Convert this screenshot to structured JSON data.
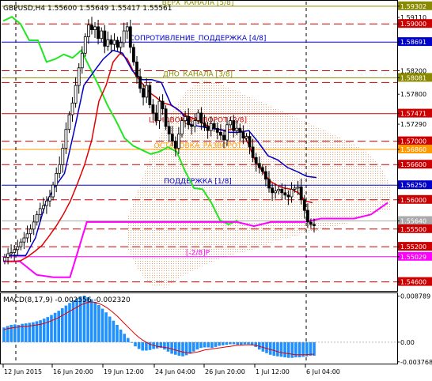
{
  "header": {
    "symbol_line": "GBPUSD,H4  1.55600 1.55649 1.55417 1.55561"
  },
  "colors": {
    "candle": "#000000",
    "red_line": "#e00000",
    "blue_line": "#0000c8",
    "green_line": "#22e622",
    "magenta_line": "#ff00ff",
    "cloud": "#e8a070",
    "macd_hist": "#1e90ff",
    "macd_signal": "#e00000"
  },
  "chart_data": [
    {
      "type": "candlestick",
      "title": "GBPUSD,H4",
      "ohlc_current": {
        "open": 1.556,
        "high": 1.55649,
        "low": 1.55417,
        "close": 1.55561
      },
      "ylim": [
        1.5446,
        1.5938
      ],
      "levels": [
        {
          "label": "ВЕРХ_КАНАЛА [5/8]",
          "price": 1.593,
          "color": "#8a8a00",
          "style": "solid"
        },
        {
          "label": "",
          "price": 1.59,
          "color": "#cc0000",
          "style": "dashed"
        },
        {
          "label": "СОПРОТИВЛЕНИЕ_ПОДДЕРЖКА [4/8]",
          "price": 1.5869,
          "color": "#0000cc",
          "style": "solid"
        },
        {
          "label": "",
          "price": 1.582,
          "color": "#cc0000",
          "style": "dashed"
        },
        {
          "label": "ДНО_КАНАЛА [3/8]",
          "price": 1.5808,
          "color": "#8a8a00",
          "style": "solid"
        },
        {
          "label": "",
          "price": 1.58,
          "color": "#cc0000",
          "style": "dashed"
        },
        {
          "label": "",
          "price": 1.5747,
          "color": "#cc0000",
          "style": "solid"
        },
        {
          "label": "ЦЕНОВОЙ_РАЗВОРОТ [2/8]",
          "price": 1.573,
          "color": "#cc0000",
          "style": "label"
        },
        {
          "label": "",
          "price": 1.57,
          "color": "#cc0000",
          "style": "dashed"
        },
        {
          "label": "ОСТАНОВКА_РАЗВОРОТ",
          "price": 1.5686,
          "color": "#ff9900",
          "style": "solid"
        },
        {
          "label": "",
          "price": 1.566,
          "color": "#cc0000",
          "style": "dashed"
        },
        {
          "label": "ПОДДЕРЖКА [1/8]",
          "price": 1.5625,
          "color": "#0000cc",
          "style": "solid"
        },
        {
          "label": "",
          "price": 1.56,
          "color": "#cc0000",
          "style": "dashed"
        },
        {
          "label": "",
          "price": 1.5564,
          "color": "#aaaaaa",
          "style": "solid"
        },
        {
          "label": "",
          "price": 1.555,
          "color": "#cc0000",
          "style": "dashed"
        },
        {
          "label": "",
          "price": 1.552,
          "color": "#cc0000",
          "style": "dashed"
        },
        {
          "label": "[-2/8]P",
          "price": 1.5503,
          "color": "#ff00ff",
          "style": "solid"
        },
        {
          "label": "",
          "price": 1.546,
          "color": "#cc0000",
          "style": "dashed"
        }
      ],
      "price_axis": [
        {
          "label": "1.59302",
          "price": 1.59302,
          "box": "#8a8a00"
        },
        {
          "label": "1.59110",
          "price": 1.5911,
          "box": ""
        },
        {
          "label": "1.59000",
          "price": 1.59,
          "box": "#cc0000"
        },
        {
          "label": "1.58691",
          "price": 1.58691,
          "box": "#0000cc"
        },
        {
          "label": "1.58200",
          "price": 1.582,
          "box": ""
        },
        {
          "label": "1.58081",
          "price": 1.58081,
          "box": "#8a8a00"
        },
        {
          "label": "1.57800",
          "price": 1.578,
          "box": ""
        },
        {
          "label": "1.57471",
          "price": 1.57471,
          "box": "#cc0000"
        },
        {
          "label": "1.57290",
          "price": 1.5729,
          "box": ""
        },
        {
          "label": "1.57000",
          "price": 1.57,
          "box": "#cc0000"
        },
        {
          "label": "1.56860",
          "price": 1.5686,
          "box": "#ff9900"
        },
        {
          "label": "1.56600",
          "price": 1.566,
          "box": "#cc0000"
        },
        {
          "label": "1.56250",
          "price": 1.5625,
          "box": "#0000cc"
        },
        {
          "label": "1.56000",
          "price": 1.56,
          "box": "#cc0000"
        },
        {
          "label": "1.55640",
          "price": 1.5564,
          "box": "#aaaaaa"
        },
        {
          "label": "1.55500",
          "price": 1.555,
          "box": "#cc0000"
        },
        {
          "label": "1.55200",
          "price": 1.552,
          "box": "#cc0000"
        },
        {
          "label": "1.55029",
          "price": 1.55029,
          "box": "#ff00ff"
        },
        {
          "label": "1.54600",
          "price": 1.546,
          "box": "#cc0000"
        }
      ],
      "time_axis": [
        "12 Jun 2015",
        "16 Jun 20:00",
        "19 Jun 12:00",
        "24 Jun 04:00",
        "26 Jun 20:00",
        "1 Jul 12:00",
        "6 Jul 04:00"
      ],
      "closes": [
        1.5502,
        1.5508,
        1.551,
        1.5515,
        1.552,
        1.5528,
        1.5535,
        1.5542,
        1.555,
        1.5562,
        1.5575,
        1.5585,
        1.559,
        1.5598,
        1.5605,
        1.5625,
        1.5645,
        1.566,
        1.5688,
        1.572,
        1.5745,
        1.5765,
        1.5795,
        1.5825,
        1.585,
        1.5878,
        1.5898,
        1.589,
        1.5895,
        1.5875,
        1.5888,
        1.5862,
        1.5873,
        1.5865,
        1.5872,
        1.586,
        1.5868,
        1.5888,
        1.5895,
        1.586,
        1.5835,
        1.581,
        1.579,
        1.5775,
        1.5795,
        1.5762,
        1.5748,
        1.5735,
        1.5768,
        1.5755,
        1.5725,
        1.5712,
        1.57,
        1.5688,
        1.5712,
        1.5735,
        1.5742,
        1.5728,
        1.5725,
        1.5735,
        1.5748,
        1.5731,
        1.5725,
        1.5718,
        1.573,
        1.5722,
        1.5715,
        1.571,
        1.5702,
        1.5728,
        1.5735,
        1.5718,
        1.5722,
        1.5715,
        1.5705,
        1.5708,
        1.569,
        1.5672,
        1.5662,
        1.5655,
        1.5648,
        1.5635,
        1.562,
        1.5612,
        1.5615,
        1.5618,
        1.5612,
        1.5608,
        1.5605,
        1.5618,
        1.562,
        1.5622,
        1.56,
        1.5582,
        1.5562,
        1.5558,
        1.5556
      ],
      "red_line": [
        1.5495,
        1.5495,
        1.5496,
        1.5503,
        1.5512,
        1.5522,
        1.5538,
        1.5555,
        1.5575,
        1.5598,
        1.5628,
        1.566,
        1.5702,
        1.5768,
        1.5795,
        1.5835,
        1.585,
        1.584,
        1.5815,
        1.58,
        1.5784,
        1.5775,
        1.5765,
        1.5762,
        1.5755,
        1.5745,
        1.574,
        1.5735,
        1.5728,
        1.5722,
        1.572,
        1.5718,
        1.5722,
        1.5718,
        1.5695,
        1.5665,
        1.5648,
        1.5632,
        1.5625,
        1.562,
        1.5618,
        1.5612,
        1.5598,
        1.5595
      ],
      "blue_line": [
        1.5505,
        1.5505,
        1.5505,
        1.5535,
        1.5592,
        1.5622,
        1.5645,
        1.5718,
        1.5795,
        1.5818,
        1.584,
        1.5855,
        1.585,
        1.582,
        1.5805,
        1.5805,
        1.58,
        1.5762,
        1.575,
        1.5728,
        1.5725,
        1.5722,
        1.572,
        1.5715,
        1.5715,
        1.5718,
        1.5698,
        1.5675,
        1.5668,
        1.5655,
        1.5648,
        1.564,
        1.5638
      ],
      "green_line": [
        1.5905,
        1.5912,
        1.59,
        1.5872,
        1.5872,
        1.5835,
        1.584,
        1.5848,
        1.5842,
        1.5855,
        1.5825,
        1.5795,
        1.5762,
        1.5735,
        1.5705,
        1.5692,
        1.5685,
        1.5678,
        1.5682,
        1.569,
        1.5682,
        1.5648,
        1.562,
        1.5618,
        1.5595,
        1.5565,
        1.5558,
        1.5565
      ],
      "magenta_line": [
        1.5495,
        1.5495,
        1.5472,
        1.5468,
        1.5468,
        1.5562,
        1.5562,
        1.5562,
        1.5562,
        1.5562,
        1.5562,
        1.5562,
        1.5562,
        1.5562,
        1.5562,
        1.5555,
        1.5562,
        1.5562,
        1.5562,
        1.5568,
        1.5568,
        1.5568,
        1.5575,
        1.5595
      ]
    },
    {
      "type": "bar",
      "title": "MACD(8,17,9) -0.002556 -0.002320",
      "ylim": [
        -0.0038,
        0.0089
      ],
      "axis_labels": [
        {
          "label": "0.008789",
          "value": 0.008789
        },
        {
          "label": "0.00",
          "value": 0.0
        },
        {
          "label": "-0.003768",
          "value": -0.003768
        }
      ],
      "histogram": [
        0.0028,
        0.0031,
        0.0033,
        0.0034,
        0.0033,
        0.0035,
        0.0036,
        0.0037,
        0.0038,
        0.004,
        0.0042,
        0.0045,
        0.0048,
        0.0052,
        0.0056,
        0.006,
        0.0065,
        0.007,
        0.0075,
        0.008,
        0.0084,
        0.0087,
        0.0089,
        0.0086,
        0.0082,
        0.0077,
        0.0071,
        0.0064,
        0.0057,
        0.0049,
        0.0041,
        0.0033,
        0.0024,
        0.0016,
        0.0008,
        0.0,
        -0.0008,
        -0.0013,
        -0.0016,
        -0.0016,
        -0.0015,
        -0.0013,
        -0.0012,
        -0.0011,
        -0.0014,
        -0.0018,
        -0.0022,
        -0.0024,
        -0.0026,
        -0.0027,
        -0.0025,
        -0.0022,
        -0.0018,
        -0.0014,
        -0.0011,
        -0.001,
        -0.001,
        -0.0011,
        -0.0009,
        -0.0007,
        -0.0006,
        -0.0005,
        -0.0004,
        -0.0004,
        -0.0005,
        -0.0005,
        -0.0004,
        -0.0004,
        -0.0006,
        -0.0009,
        -0.0014,
        -0.0018,
        -0.0021,
        -0.0024,
        -0.0026,
        -0.0027,
        -0.0028,
        -0.0029,
        -0.003,
        -0.003,
        -0.0029,
        -0.0029,
        -0.0028,
        -0.0027,
        -0.0026,
        -0.0026
      ],
      "signal": [
        0.0024,
        0.0026,
        0.0027,
        0.0028,
        0.0029,
        0.003,
        0.003,
        0.0031,
        0.0032,
        0.0033,
        0.0034,
        0.0036,
        0.0038,
        0.0041,
        0.0044,
        0.0047,
        0.0051,
        0.0055,
        0.0059,
        0.0063,
        0.0067,
        0.0071,
        0.0074,
        0.0076,
        0.0077,
        0.0076,
        0.0074,
        0.0071,
        0.0067,
        0.0062,
        0.0056,
        0.005,
        0.0043,
        0.0036,
        0.0029,
        0.0022,
        0.0015,
        0.0009,
        0.0004,
        0.0,
        -0.0004,
        -0.0006,
        -0.0008,
        -0.0009,
        -0.001,
        -0.0011,
        -0.0013,
        -0.0015,
        -0.0017,
        -0.0019,
        -0.002,
        -0.0021,
        -0.002,
        -0.0019,
        -0.0017,
        -0.0015,
        -0.0014,
        -0.0013,
        -0.0012,
        -0.0011,
        -0.001,
        -0.0009,
        -0.0008,
        -0.0007,
        -0.0006,
        -0.0006,
        -0.0005,
        -0.0005,
        -0.0005,
        -0.0006,
        -0.0008,
        -0.001,
        -0.0012,
        -0.0014,
        -0.0016,
        -0.0018,
        -0.002,
        -0.0021,
        -0.0022,
        -0.0023,
        -0.0024,
        -0.0024,
        -0.0024,
        -0.0024,
        -0.0023,
        -0.0023
      ]
    }
  ]
}
